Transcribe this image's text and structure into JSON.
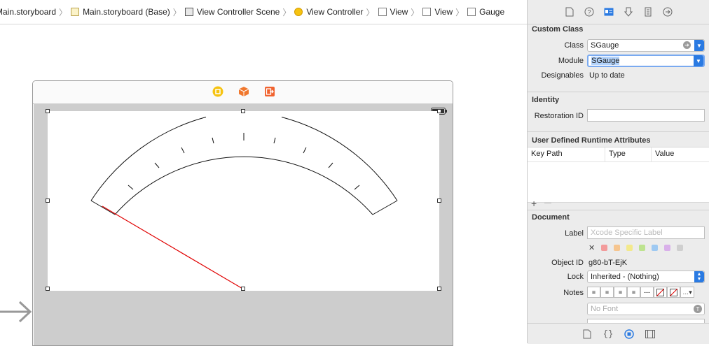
{
  "breadcrumb": [
    {
      "label": "Main.storyboard",
      "icon": "storyboard-doc-icon"
    },
    {
      "label": "Main.storyboard (Base)",
      "icon": "storyboard-doc-icon"
    },
    {
      "label": "View Controller Scene",
      "icon": "scene-icon"
    },
    {
      "label": "View Controller",
      "icon": "view-controller-icon"
    },
    {
      "label": "View",
      "icon": "view-icon"
    },
    {
      "label": "View",
      "icon": "view-icon"
    },
    {
      "label": "Gauge",
      "icon": "view-icon"
    }
  ],
  "inspector": {
    "tabs": [
      "file-icon",
      "help-icon",
      "identity-icon",
      "attributes-icon",
      "size-icon",
      "connections-icon"
    ],
    "custom_class": {
      "title": "Custom Class",
      "class_label": "Class",
      "class_value": "SGauge",
      "module_label": "Module",
      "module_value": "SGauge",
      "designables_label": "Designables",
      "designables_value": "Up to date"
    },
    "identity": {
      "title": "Identity",
      "restoration_label": "Restoration ID",
      "restoration_value": ""
    },
    "runtime_attrs": {
      "title": "User Defined Runtime Attributes",
      "columns": [
        "Key Path",
        "Type",
        "Value"
      ],
      "add": "+",
      "remove": "—"
    },
    "document": {
      "title": "Document",
      "label_label": "Label",
      "label_placeholder": "Xcode Specific Label",
      "swatch_colors": [
        "#f39b9b",
        "#f6c58f",
        "#f3e98c",
        "#bde38f",
        "#9ec9f2",
        "#d9b0ea",
        "#cfcfcf"
      ],
      "object_id_label": "Object ID",
      "object_id_value": "g80-bT-EjK",
      "lock_label": "Lock",
      "lock_value": "Inherited - (Nothing)",
      "notes_label": "Notes",
      "font_placeholder": "No Font"
    },
    "bottom_tabs": [
      "file-template-icon",
      "braces-icon",
      "object-icon",
      "media-icon"
    ]
  },
  "colors": {
    "accent": "#2a7ae2",
    "needle": "#e00000",
    "canvas_view": "#cdcdcd"
  }
}
